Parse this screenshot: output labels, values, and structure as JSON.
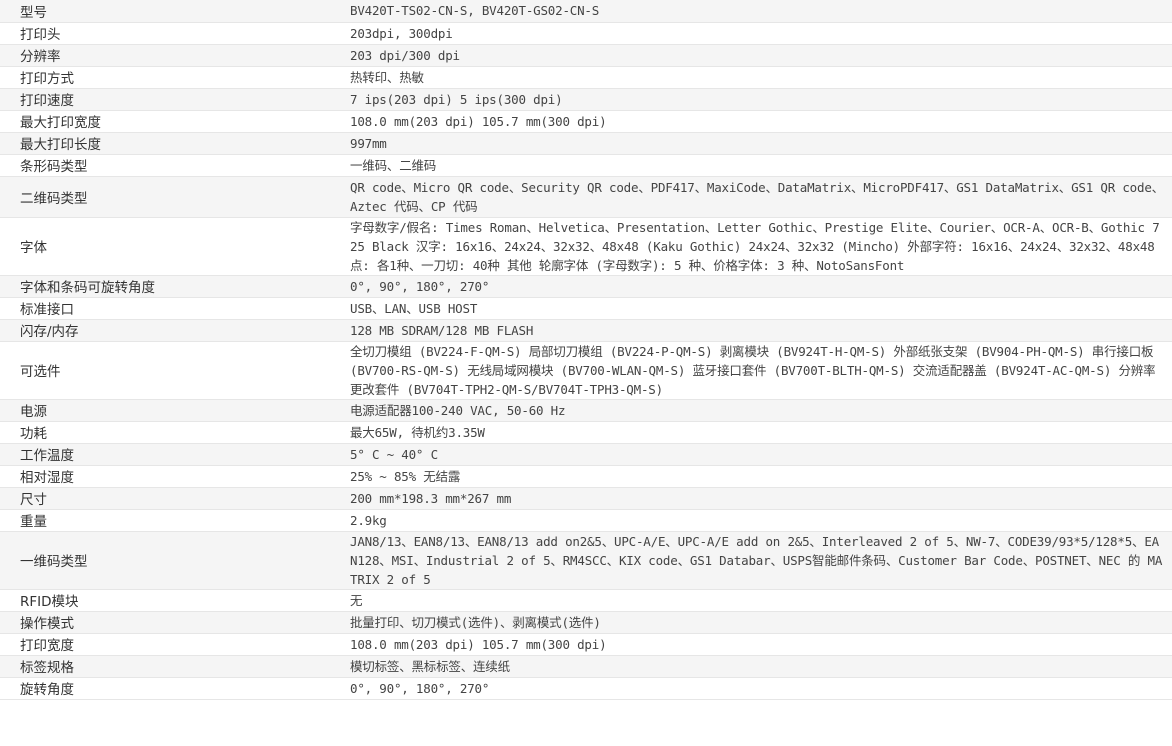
{
  "specs": [
    {
      "label": "型号",
      "value": "BV420T-TS02-CN-S, BV420T-GS02-CN-S",
      "lines": 1
    },
    {
      "label": "打印头",
      "value": "203dpi, 300dpi",
      "lines": 1
    },
    {
      "label": "分辨率",
      "value": "203 dpi/300 dpi",
      "lines": 1
    },
    {
      "label": "打印方式",
      "value": "热转印、热敏",
      "lines": 1
    },
    {
      "label": "打印速度",
      "value": "7 ips(203 dpi) 5 ips(300 dpi)",
      "lines": 1
    },
    {
      "label": "最大打印宽度",
      "value": "108.0 mm(203 dpi) 105.7 mm(300 dpi)",
      "lines": 1
    },
    {
      "label": "最大打印长度",
      "value": "997mm",
      "lines": 1
    },
    {
      "label": "条形码类型",
      "value": "一维码、二维码",
      "lines": 1
    },
    {
      "label": "二维码类型",
      "value": "QR code、Micro QR code、Security QR code、PDF417、MaxiCode、DataMatrix、MicroPDF417、GS1 DataMatrix、GS1 QR code、Aztec 代码、CP 代码",
      "lines": 2
    },
    {
      "label": "字体",
      "value": "字母数字/假名: Times Roman、Helvetica、Presentation、Letter Gothic、Prestige Elite、Courier、OCR-A、OCR-B、Gothic 725 Black 汉字: 16x16、24x24、32x32、48x48 (Kaku Gothic) 24x24、32x32 (Mincho) 外部字符: 16x16、24x24、32x32、48x48点: 各1种、一刀切: 40种 其他 轮廓字体 (字母数字): 5 种、价格字体: 3 种、NotoSansFont",
      "lines": 3
    },
    {
      "label": "字体和条码可旋转角度",
      "value": "0°, 90°, 180°, 270°",
      "lines": 1
    },
    {
      "label": "标准接口",
      "value": "USB、LAN、USB HOST",
      "lines": 1
    },
    {
      "label": "闪存/内存",
      "value": "128 MB SDRAM/128 MB FLASH",
      "lines": 1
    },
    {
      "label": "可选件",
      "value": "全切刀模组 (BV224-F-QM-S) 局部切刀模组 (BV224-P-QM-S) 剥离模块 (BV924T-H-QM-S) 外部纸张支架 (BV904-PH-QM-S) 串行接口板 (BV700-RS-QM-S) 无线局域网模块 (BV700-WLAN-QM-S) 蓝牙接口套件 (BV700T-BLTH-QM-S) 交流适配器盖 (BV924T-AC-QM-S) 分辨率更改套件 (BV704T-TPH2-QM-S/BV704T-TPH3-QM-S)",
      "lines": 3
    },
    {
      "label": "电源",
      "value": "电源适配器100-240 VAC, 50-60 Hz",
      "lines": 1
    },
    {
      "label": "功耗",
      "value": "最大65W, 待机约3.35W",
      "lines": 1
    },
    {
      "label": "工作温度",
      "value": "5° C ~ 40° C",
      "lines": 1
    },
    {
      "label": "相对湿度",
      "value": "25% ~ 85% 无结露",
      "lines": 1
    },
    {
      "label": "尺寸",
      "value": "200 mm*198.3 mm*267 mm",
      "lines": 1
    },
    {
      "label": "重量",
      "value": "2.9kg",
      "lines": 1
    },
    {
      "label": "一维码类型",
      "value": "JAN8/13、EAN8/13、EAN8/13 add on2&5、UPC-A/E、UPC-A/E add on 2&5、Interleaved 2 of 5、NW-7、CODE39/93*5/128*5、EAN128、MSI、Industrial 2 of 5、RM4SCC、KIX code、GS1 Databar、USPS智能邮件条码、Customer Bar Code、POSTNET、NEC 的 MATRIX 2 of 5",
      "lines": 3
    },
    {
      "label": "RFID模块",
      "value": "无",
      "lines": 1
    },
    {
      "label": "操作模式",
      "value": "批量打印、切刀模式(选件)、剥离模式(选件)",
      "lines": 1
    },
    {
      "label": "打印宽度",
      "value": "108.0 mm(203 dpi) 105.7 mm(300 dpi)",
      "lines": 1
    },
    {
      "label": "标签规格",
      "value": "模切标签、黑标标签、连续纸",
      "lines": 1
    },
    {
      "label": "旋转角度",
      "value": "0°, 90°, 180°, 270°",
      "lines": 1
    }
  ]
}
